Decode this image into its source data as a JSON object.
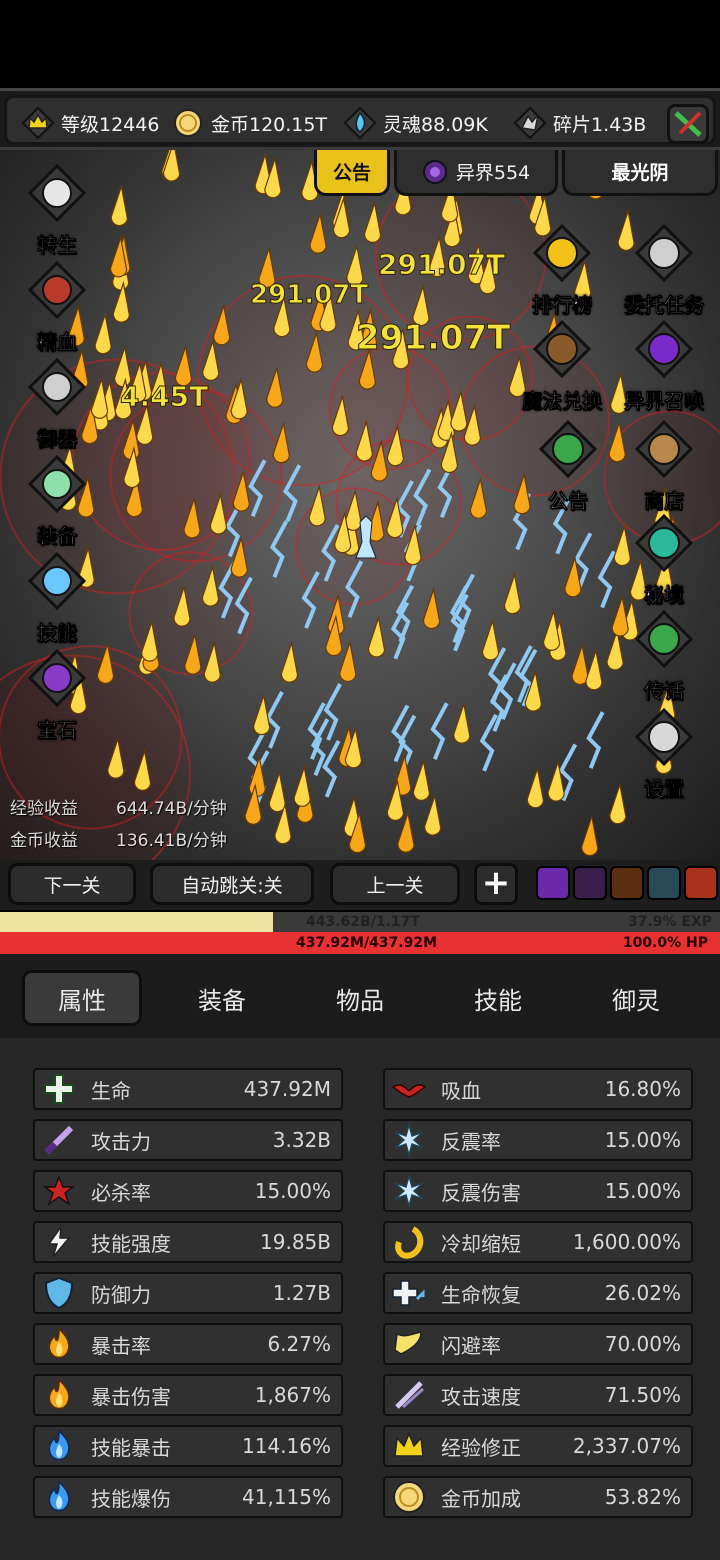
{
  "resources": [
    {
      "icon": "crown-level-icon",
      "label": "等级12446"
    },
    {
      "icon": "gold-coin-icon",
      "label": "金币120.15T"
    },
    {
      "icon": "soul-flame-icon",
      "label": "灵魂88.09K"
    },
    {
      "icon": "fragment-shard-icon",
      "label": "碎片1.43B"
    }
  ],
  "scene_tabs": {
    "notice": "公告",
    "otherworld": "异界554",
    "player_name": "最光阴"
  },
  "left_menu": [
    "转生",
    "精血",
    "御器",
    "装备",
    "技能",
    "宝石"
  ],
  "right_menu": [
    "排行榜",
    "委托任务",
    "魔法兑换",
    "异界召唤",
    "公告",
    "商店",
    "秘境",
    "传话",
    "设置"
  ],
  "stats": [
    {
      "label": "经验收益",
      "value": "644.74B/分钟"
    },
    {
      "label": "金币收益",
      "value": "136.41B/分钟"
    }
  ],
  "floating_damage": [
    "291.07T",
    "291.07T",
    "291.07T",
    "4.45T"
  ],
  "nav": {
    "next": "下一关",
    "auto_skip": "自动跳关:关",
    "prev": "上一关",
    "plus": "+"
  },
  "exp": {
    "text": "443.62B/1.17T",
    "percent_text": "37.9% EXP",
    "fraction": 0.379
  },
  "hp": {
    "text": "437.92M/437.92M",
    "percent_text": "100.0%  HP",
    "fraction": 1.0
  },
  "tabs": [
    "属性",
    "装备",
    "物品",
    "技能",
    "御灵"
  ],
  "attributes_left": [
    {
      "icon": "health-cross-icon",
      "name": "生命",
      "value": "437.92M"
    },
    {
      "icon": "sword-icon",
      "name": "攻击力",
      "value": "3.32B"
    },
    {
      "icon": "critical-kill-icon",
      "name": "必杀率",
      "value": "15.00%"
    },
    {
      "icon": "lightning-icon",
      "name": "技能强度",
      "value": "19.85B"
    },
    {
      "icon": "shield-icon",
      "name": "防御力",
      "value": "1.27B"
    },
    {
      "icon": "fire-icon",
      "name": "暴击率",
      "value": "6.27%"
    },
    {
      "icon": "fire-icon",
      "name": "暴击伤害",
      "value": "1,867%"
    },
    {
      "icon": "blue-fire-icon",
      "name": "技能暴击",
      "value": "114.16%"
    },
    {
      "icon": "blue-fire-icon",
      "name": "技能爆伤",
      "value": "41,115%"
    }
  ],
  "attributes_right": [
    {
      "icon": "bat-icon",
      "name": "吸血",
      "value": "16.80%"
    },
    {
      "icon": "reflect-icon",
      "name": "反震率",
      "value": "15.00%"
    },
    {
      "icon": "reflect-icon",
      "name": "反震伤害",
      "value": "15.00%"
    },
    {
      "icon": "cooldown-icon",
      "name": "冷却缩短",
      "value": "1,600.00%"
    },
    {
      "icon": "regen-icon",
      "name": "生命恢复",
      "value": "26.02%"
    },
    {
      "icon": "dodge-boot-icon",
      "name": "闪避率",
      "value": "70.00%"
    },
    {
      "icon": "attack-speed-icon",
      "name": "攻击速度",
      "value": "71.50%"
    },
    {
      "icon": "crown-icon",
      "name": "经验修正",
      "value": "2,337.07%"
    },
    {
      "icon": "gold-coin-icon",
      "name": "金币加成",
      "value": "53.82%"
    }
  ],
  "colors": {
    "exp_fill": "#f0e2a0",
    "hp_fill": "#e63232",
    "notice_tab": "#e8c21a",
    "damage_text": "#f2e23a"
  }
}
